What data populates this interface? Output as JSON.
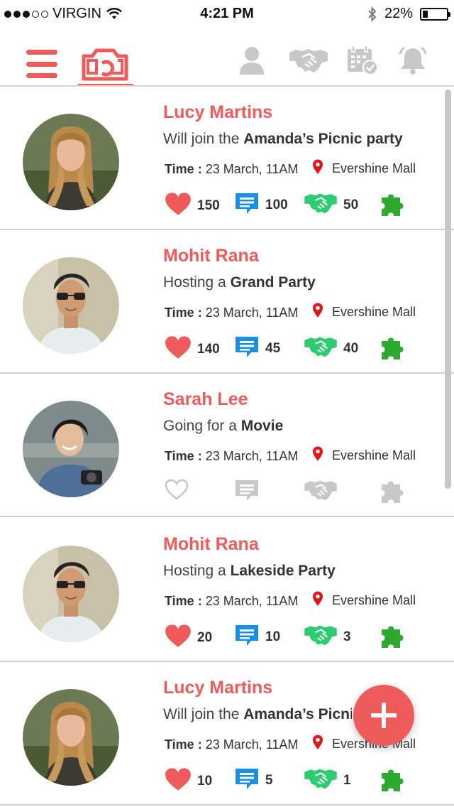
{
  "status_bar": {
    "carrier": "VIRGIN",
    "time": "4:21 PM",
    "battery": "22%",
    "battery_level": 0.22
  },
  "navbar": {
    "active_tab": "camera",
    "accent_color": "#ef5b5b",
    "inactive_color": "#c8c8c8",
    "icons": [
      "menu-icon",
      "camera-icon",
      "profile-icon",
      "handshake-icon",
      "calendar-icon",
      "bell-icon"
    ]
  },
  "feed": {
    "time_label": "Time :",
    "items": [
      {
        "name": "Lucy Martins",
        "activity_prefix": "Will join the ",
        "activity_bold": "Amanda’s Picnic party",
        "time": " 23 March, 11AM",
        "location": "Evershine Mall",
        "likes": "150",
        "comments": "100",
        "joins": "50",
        "active": true,
        "avatar": "woman-blonde"
      },
      {
        "name": "Mohit Rana",
        "activity_prefix": "Hosting a ",
        "activity_bold": "Grand Party",
        "time": " 23 March, 11AM",
        "location": "Evershine Mall",
        "likes": "140",
        "comments": "45",
        "joins": "40",
        "active": true,
        "avatar": "man-sunglasses"
      },
      {
        "name": "Sarah Lee",
        "activity_prefix": "Going for  a ",
        "activity_bold": "Movie",
        "time": " 23 March, 11AM",
        "location": "Evershine Mall",
        "likes": "",
        "comments": "",
        "joins": "",
        "active": false,
        "avatar": "woman-denim"
      },
      {
        "name": "Mohit Rana",
        "activity_prefix": "Hosting a ",
        "activity_bold": "Lakeside Party",
        "time": " 23 March, 11AM",
        "location": "Evershine Mall",
        "likes": "20",
        "comments": "10",
        "joins": "3",
        "active": true,
        "avatar": "man-sunglasses"
      },
      {
        "name": "Lucy Martins",
        "activity_prefix": "Will join the ",
        "activity_bold": "Amanda’s Picnic",
        "time": " 23 March, 11AM",
        "location": "Evershine Mall",
        "likes": "10",
        "comments": "5",
        "joins": "1",
        "active": true,
        "avatar": "woman-blonde"
      }
    ]
  },
  "colors": {
    "heart": "#ef5b5b",
    "comment": "#1a8fe3",
    "handshake": "#2ecc71",
    "puzzle": "#2eaa2e",
    "inactive": "#c8c8c8",
    "location_pin": "#e0161b"
  },
  "fab": {
    "icon": "plus-icon"
  }
}
